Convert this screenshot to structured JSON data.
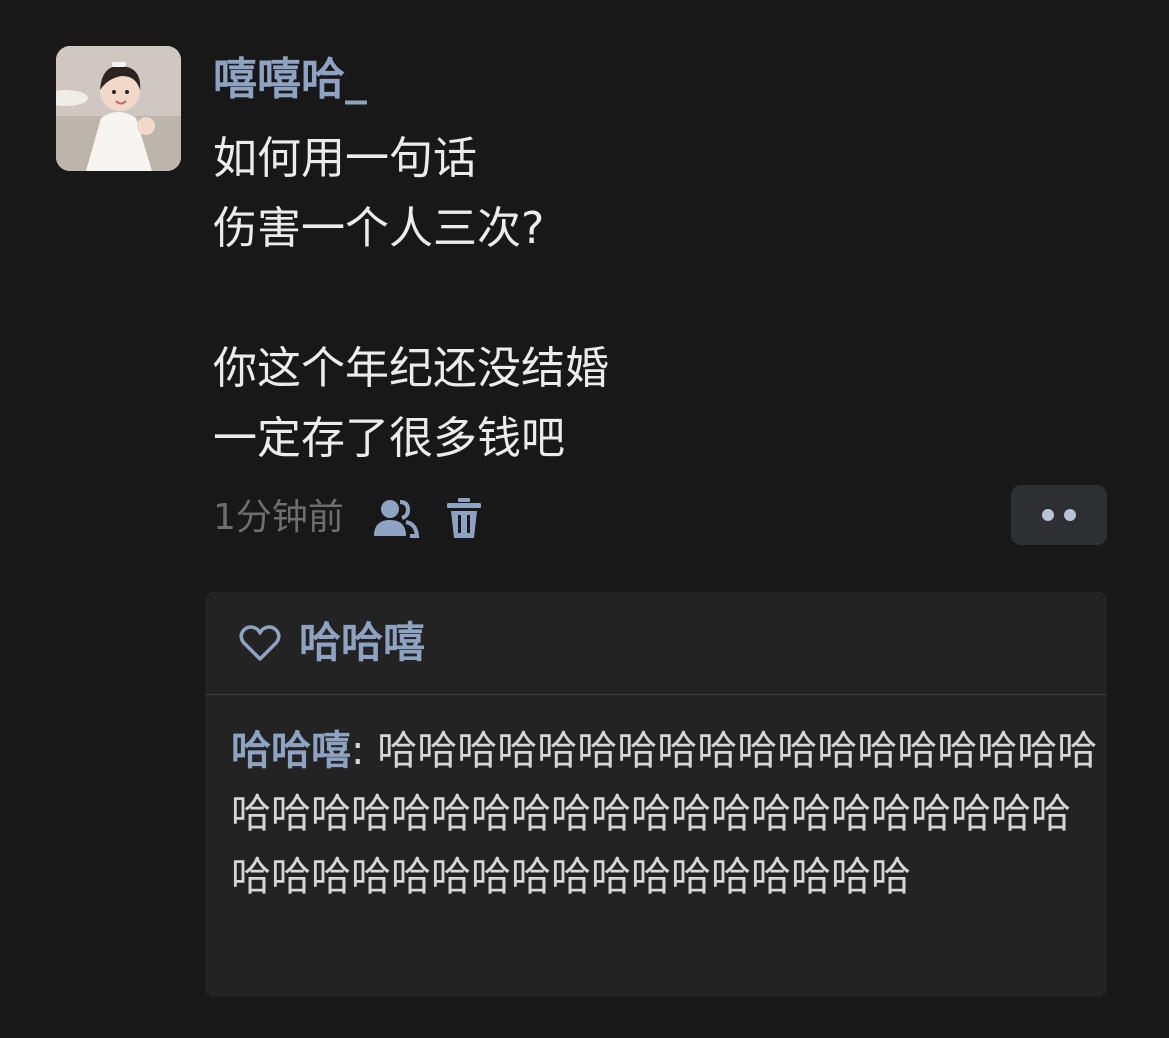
{
  "post": {
    "username": "嘻嘻哈_",
    "content_lines": [
      "如何用一句话",
      "伤害一个人三次?",
      "",
      "你这个年纪还没结婚",
      "一定存了很多钱吧"
    ],
    "timestamp": "1分钟前",
    "icons": {
      "avatar": "avatar-photo",
      "visibility": "friends-icon",
      "delete": "trash-icon",
      "more": "more-dots-icon"
    }
  },
  "likes": {
    "icon": "heart-icon",
    "names": "哈哈嘻"
  },
  "comment": {
    "author": "哈哈嘻",
    "separator": ": ",
    "text": "哈哈哈哈哈哈哈哈哈哈哈哈哈哈哈哈哈哈哈哈哈哈哈哈哈哈哈哈哈哈哈哈哈哈哈哈哈哈哈哈哈哈哈哈哈哈哈哈哈哈哈哈哈哈哈哈"
  },
  "colors": {
    "background": "#181818",
    "name_accent": "#8ea3c2",
    "panel": "#232323",
    "timestamp": "#6d6d6d"
  }
}
